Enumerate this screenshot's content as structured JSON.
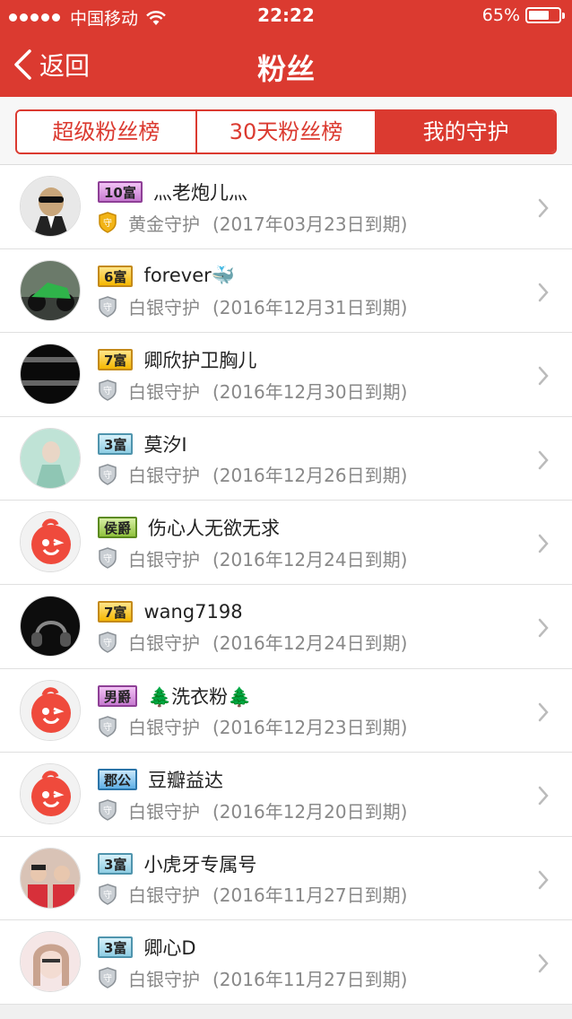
{
  "status": {
    "carrier": "中国移动",
    "time": "22:22",
    "battery": "65%",
    "battery_level": 0.65
  },
  "header": {
    "back_label": "返回",
    "title": "粉丝"
  },
  "tabs": [
    {
      "label": "超级粉丝榜",
      "active": false
    },
    {
      "label": "30天粉丝榜",
      "active": false
    },
    {
      "label": "我的守护",
      "active": true
    }
  ],
  "rows": [
    {
      "badge": "10富",
      "badge_color": "#d98ce0",
      "name": "灬老炮儿灬",
      "guard": "黄金守护",
      "expiry": "(2017年03月23日到期)",
      "shield": "gold"
    },
    {
      "badge": "6富",
      "badge_color": "#f5c530",
      "name": "forever🐳",
      "guard": "白银守护",
      "expiry": "(2016年12月31日到期)",
      "shield": "silver"
    },
    {
      "badge": "7富",
      "badge_color": "#f5c530",
      "name": "卿欣护卫胸儿",
      "guard": "白银守护",
      "expiry": "(2016年12月30日到期)",
      "shield": "silver"
    },
    {
      "badge": "3富",
      "badge_color": "#9ad3e6",
      "name": "莫汐I",
      "guard": "白银守护",
      "expiry": "(2016年12月26日到期)",
      "shield": "silver"
    },
    {
      "badge": "侯爵",
      "badge_color": "#9ccc4a",
      "name": "伤心人无欲无求",
      "guard": "白银守护",
      "expiry": "(2016年12月24日到期)",
      "shield": "silver"
    },
    {
      "badge": "7富",
      "badge_color": "#f5c530",
      "name": "wang7198",
      "guard": "白银守护",
      "expiry": "(2016年12月24日到期)",
      "shield": "silver"
    },
    {
      "badge": "男爵",
      "badge_color": "#d98ce0",
      "name": "🌲洗衣粉🌲",
      "guard": "白银守护",
      "expiry": "(2016年12月23日到期)",
      "shield": "silver"
    },
    {
      "badge": "郡公",
      "badge_color": "#6cb8e8",
      "name": "豆瓣益达",
      "guard": "白银守护",
      "expiry": "(2016年12月20日到期)",
      "shield": "silver"
    },
    {
      "badge": "3富",
      "badge_color": "#9ad3e6",
      "name": "小虎牙专属号",
      "guard": "白银守护",
      "expiry": "(2016年11月27日到期)",
      "shield": "silver"
    },
    {
      "badge": "3富",
      "badge_color": "#9ad3e6",
      "name": "卿心D",
      "guard": "白银守护",
      "expiry": "(2016年11月27日到期)",
      "shield": "silver"
    }
  ],
  "colors": {
    "accent": "#db3a30"
  }
}
